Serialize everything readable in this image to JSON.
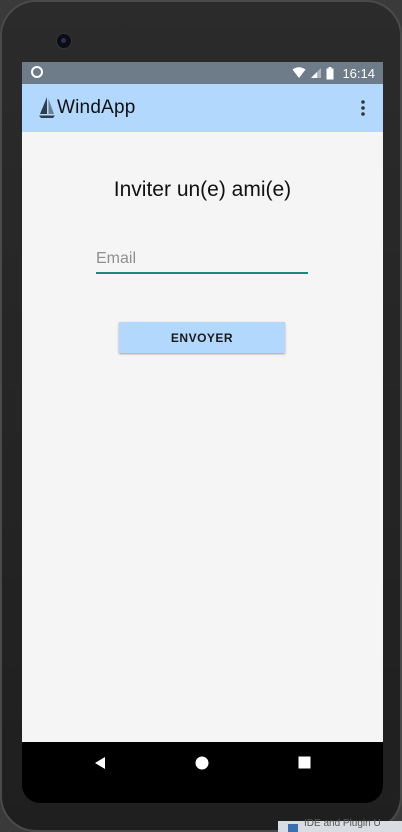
{
  "status_bar": {
    "time": "16:14",
    "icons": [
      "circle-icon",
      "wifi-icon",
      "signal-icon",
      "battery-icon"
    ]
  },
  "app_bar": {
    "title": "WindApp",
    "logo_icon": "sailboat-icon",
    "menu_icon": "overflow-menu-icon",
    "background": "#b2d8fd"
  },
  "invite": {
    "heading": "Inviter un(e) ami(e)",
    "email_placeholder": "Email",
    "email_value": "",
    "send_label": "ENVOYER",
    "field_accent": "#1b8a7c"
  },
  "nav_bar": {
    "buttons": [
      "back-icon",
      "home-icon",
      "recents-icon"
    ]
  },
  "taskbar_peek": {
    "text": "IDE and Plugin U"
  }
}
